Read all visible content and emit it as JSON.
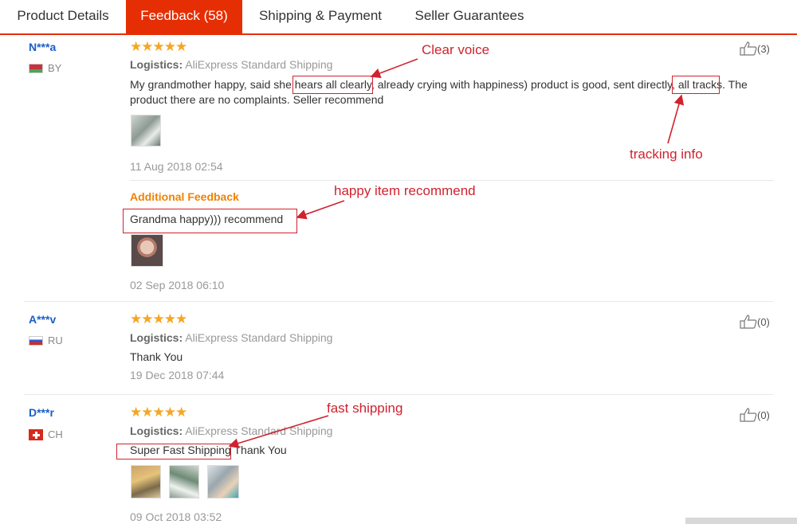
{
  "tabs": [
    {
      "label": "Product Details"
    },
    {
      "label": "Feedback (58)"
    },
    {
      "label": "Shipping & Payment"
    },
    {
      "label": "Seller Guarantees"
    }
  ],
  "logistics_label": "Logistics:",
  "additional_label": "Additional Feedback",
  "reviews": [
    {
      "user": "N***a",
      "country": "BY",
      "rating": 5,
      "logistics": "AliExpress Standard Shipping",
      "text_line1": "My grandmother happy, said she hears all clearly, already crying with happiness) product is good, sent directly, all tracks. The",
      "text_line2": "product there are no complaints. Seller recommend",
      "date": "11 Aug 2018 02:54",
      "likes": "(3)",
      "additional": {
        "text": "Grandma happy))) recommend",
        "date": "02 Sep 2018 06:10"
      }
    },
    {
      "user": "A***v",
      "country": "RU",
      "rating": 5,
      "logistics": "AliExpress Standard Shipping",
      "text": "Thank You",
      "date": "19 Dec 2018 07:44",
      "likes": "(0)"
    },
    {
      "user": "D***r",
      "country": "CH",
      "rating": 5,
      "logistics": "AliExpress Standard Shipping",
      "text": "Super Fast Shipping Thank You",
      "date": "09 Oct 2018 03:52",
      "likes": "(0)"
    }
  ],
  "annotations": {
    "clear_voice": "Clear voice",
    "tracking_info": "tracking info",
    "happy_item": "happy item recommend",
    "fast_shipping": "fast shipping"
  },
  "colors": {
    "accent": "#e62e04",
    "annotation": "#d0222e",
    "star": "#f5a623",
    "username": "#1a5ec8",
    "additional": "#f08200"
  }
}
